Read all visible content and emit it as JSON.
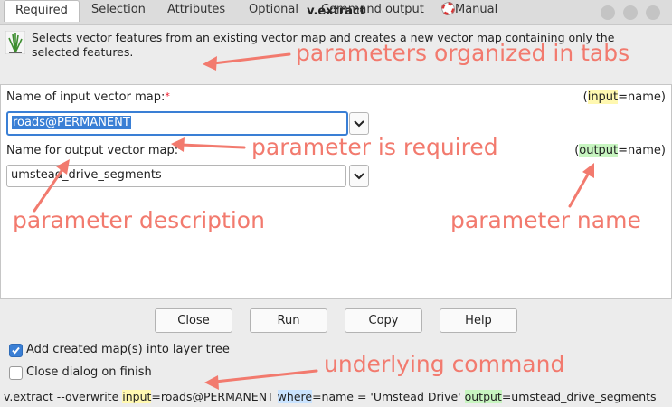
{
  "window": {
    "title": "v.extract"
  },
  "description": "Selects vector features from an existing vector map and creates a new vector map containing only the selected features.",
  "tabs": [
    {
      "label": "Required",
      "active": true
    },
    {
      "label": "Selection"
    },
    {
      "label": "Attributes"
    },
    {
      "label": "Optional"
    },
    {
      "label": "Command output"
    },
    {
      "label": "Manual"
    }
  ],
  "params": {
    "input": {
      "label": "Name of input vector map:",
      "required_mark": "*",
      "name_open": "(",
      "name": "input",
      "name_close": "=name)",
      "value": "roads@PERMANENT"
    },
    "output": {
      "label": "Name for output vector map:",
      "required_mark": "*",
      "name_open": "(",
      "name": "output",
      "name_close": "=name)",
      "value": "umstead_drive_segments"
    }
  },
  "buttons": {
    "close": "Close",
    "run": "Run",
    "copy": "Copy",
    "help": "Help"
  },
  "options": {
    "add_to_tree": {
      "label": "Add created map(s) into layer tree",
      "checked": true
    },
    "close_on_finish": {
      "label": "Close dialog on finish",
      "checked": false
    }
  },
  "command": {
    "prefix": "v.extract --overwrite ",
    "input_key": "input",
    "input_val": "=roads@PERMANENT ",
    "where_key": "where",
    "where_val": "=name = 'Umstead Drive' ",
    "output_key": "output",
    "output_val": "=umstead_drive_segments"
  },
  "annotations": {
    "tabs": "parameters organized in tabs",
    "required": "parameter is required",
    "description": "parameter description",
    "name": "parameter name",
    "command": "underlying command"
  },
  "colors": {
    "annotation": "#f27a6e",
    "highlight_input": "#fff8b0",
    "highlight_output": "#c7f5c0",
    "highlight_where": "#c9e3ff",
    "focus": "#3a7fd5"
  },
  "icons": [
    "grass-logo-icon",
    "manual-lifebuoy-icon",
    "chevron-down-icon",
    "checkbox-checked-icon",
    "checkbox-empty-icon"
  ]
}
